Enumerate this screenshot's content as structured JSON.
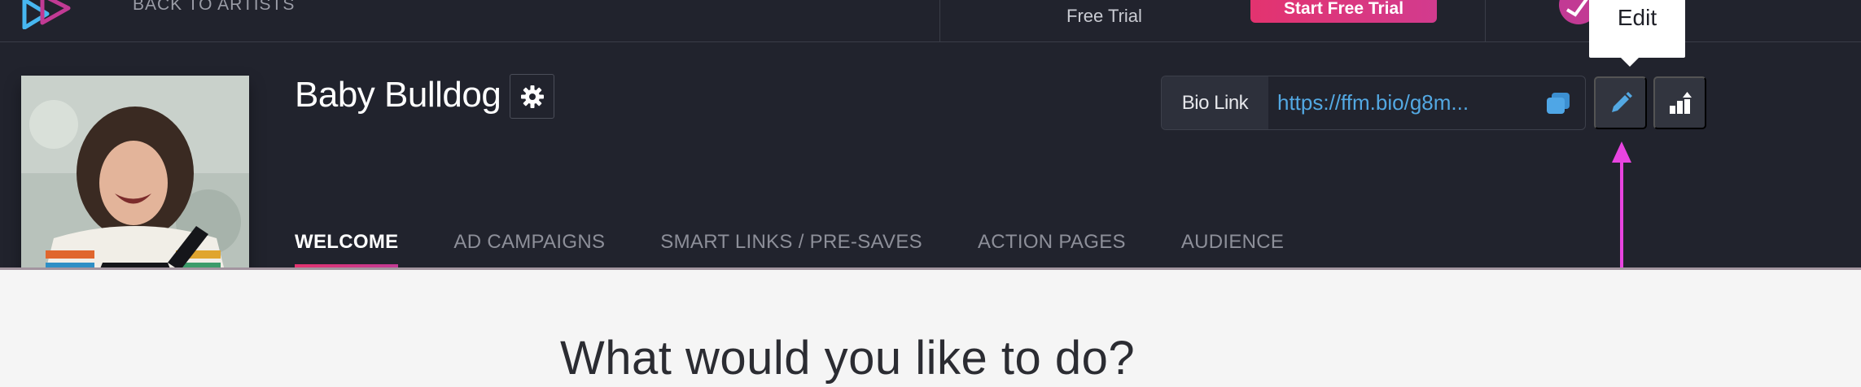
{
  "topbar": {
    "back_label": "BACK TO ARTISTS",
    "free_trial_text": "Free Trial",
    "start_trial_label": "Start Free Trial"
  },
  "artist": {
    "name": "Baby Bulldog"
  },
  "bio": {
    "label": "Bio Link",
    "url": "https://ffm.bio/g8m..."
  },
  "tooltip": {
    "text": "Edit"
  },
  "tabs": [
    {
      "label": "WELCOME",
      "active": true
    },
    {
      "label": "AD CAMPAIGNS",
      "active": false
    },
    {
      "label": "SMART LINKS / PRE-SAVES",
      "active": false
    },
    {
      "label": "ACTION PAGES",
      "active": false
    },
    {
      "label": "AUDIENCE",
      "active": false
    }
  ],
  "main": {
    "prompt": "What would you like to do?"
  },
  "colors": {
    "accent_pink": "#e3336f",
    "arrow_magenta": "#e844e0",
    "link_blue": "#53a8e2",
    "header_bg": "#21232d"
  },
  "icons": [
    "logo-icon",
    "gear-icon",
    "copy-icon",
    "pencil-icon",
    "stats-icon",
    "arrow-up-icon"
  ]
}
